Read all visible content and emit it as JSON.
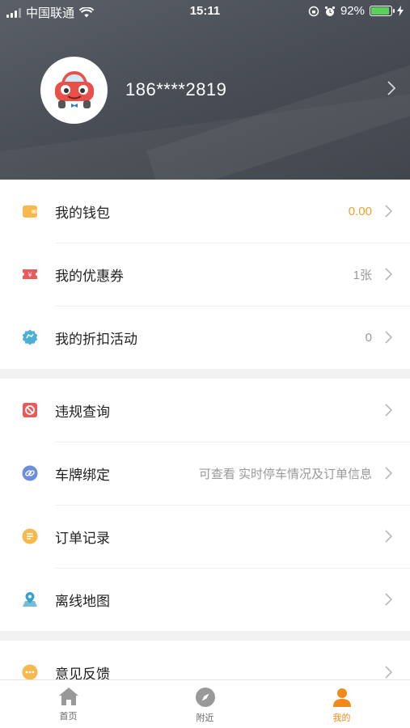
{
  "status_bar": {
    "carrier": "中国联通",
    "time": "15:11",
    "battery": "92%",
    "battery_level": 0.92
  },
  "profile": {
    "phone": "186****2819"
  },
  "section1": {
    "items": [
      {
        "label": "我的钱包",
        "value": "0.00",
        "icon": "wallet-icon",
        "color": "#f5b94d"
      },
      {
        "label": "我的优惠券",
        "value": "1张",
        "icon": "coupon-icon",
        "color": "#e95b5b"
      },
      {
        "label": "我的折扣活动",
        "value": "0",
        "icon": "discount-badge-icon",
        "color": "#4cb0d6"
      }
    ]
  },
  "section2": {
    "items": [
      {
        "label": "违规查询",
        "value": "",
        "icon": "violation-icon",
        "color": "#e95b5b"
      },
      {
        "label": "车牌绑定",
        "value": "可查看 实时停车情况及订单信息",
        "icon": "link-icon",
        "color": "#6b8de0"
      },
      {
        "label": "订单记录",
        "value": "",
        "icon": "order-list-icon",
        "color": "#f5b94d"
      },
      {
        "label": "离线地图",
        "value": "",
        "icon": "map-pin-icon",
        "color": "#3aa2c9"
      }
    ]
  },
  "section3": {
    "items": [
      {
        "label": "意见反馈",
        "value": "",
        "icon": "feedback-icon",
        "color": "#f5b94d"
      }
    ]
  },
  "tabbar": {
    "tabs": [
      {
        "label": "首页",
        "icon": "home-icon"
      },
      {
        "label": "附近",
        "icon": "compass-icon"
      },
      {
        "label": "我的",
        "icon": "person-icon",
        "active": true
      }
    ]
  },
  "colors": {
    "accent": "#f08a1c",
    "value_orange": "#f0a030"
  }
}
